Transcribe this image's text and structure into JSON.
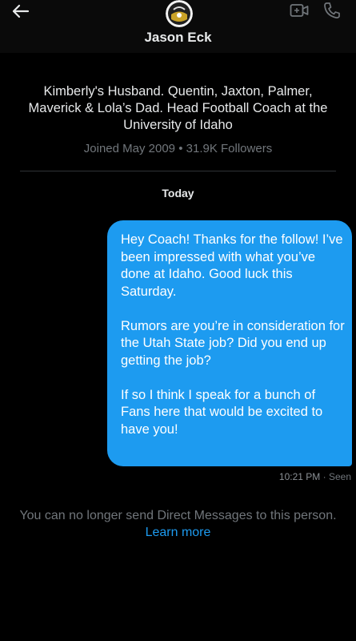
{
  "header": {
    "title": "Jason Eck",
    "back_icon": "arrow-left-icon",
    "video_icon": "video-call-icon",
    "phone_icon": "phone-icon"
  },
  "profile": {
    "bio": "Kimberly's Husband. Quentin, Jaxton, Palmer, Maverick & Lola’s Dad. Head Football Coach at the University of Idaho",
    "joined": "Joined May 2009",
    "separator": "•",
    "followers": "31.9K Followers"
  },
  "conversation": {
    "date_label": "Today",
    "messages": [
      {
        "paragraphs": [
          "Hey Coach! Thanks for the follow! I’ve been impressed with what you’ve done at Idaho. Good luck this Saturday.",
          "Rumors are you’re in consideration for the Utah State job? Did you end up getting the job?",
          "If so I think I speak for a bunch of Fans here that would be excited to have you!"
        ],
        "time": "10:21 PM",
        "status": "Seen"
      }
    ]
  },
  "footer": {
    "notice": "You can no longer send Direct Messages to this person.",
    "link": "Learn more"
  },
  "colors": {
    "background": "#000000",
    "bubble": "#1d9bf0",
    "link": "#1d9bf0",
    "muted": "#71767b"
  }
}
